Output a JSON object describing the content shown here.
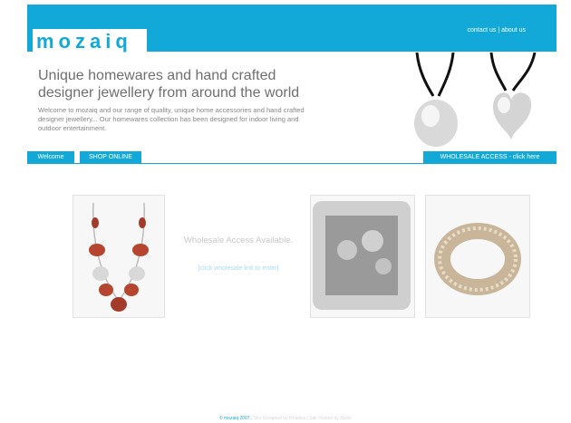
{
  "header": {
    "logo": "mozaiq",
    "links": [
      "contact us",
      "about us"
    ],
    "separator": "|"
  },
  "hero": {
    "headline_line1": "Unique homewares and hand crafted",
    "headline_line2": "designer jewellery from around the world",
    "intro": "Welcome to mozaiq and our range of quality, unique home accessories and hand crafted designer jewellery... Our homewares collection has been designed for indoor living and outdoor entertainment."
  },
  "nav": {
    "welcome": "Welcome",
    "shop": "SHOP ONLINE",
    "wholesale": "WHOLESALE ACCESS - click here"
  },
  "main": {
    "wholesale_message": "Wholesale Access Available.",
    "wholesale_link": "[click wholesale link to enter]"
  },
  "footer": {
    "copyright": "© mozaiq 2007",
    "credits": " | Site Designed by Rhadius | Site Hosted by Rivon"
  },
  "colors": {
    "accent": "#12a9d9"
  }
}
